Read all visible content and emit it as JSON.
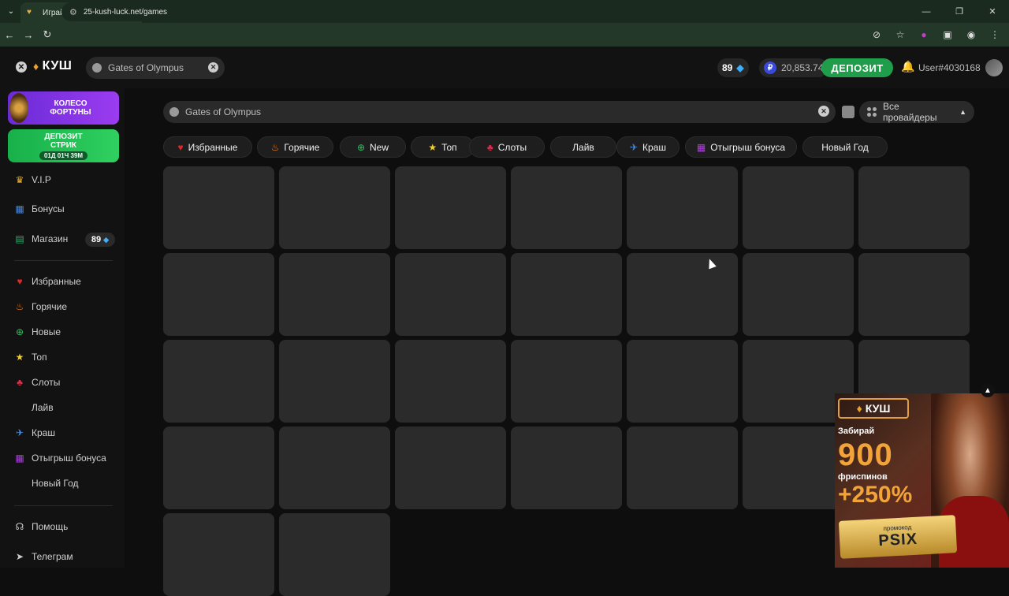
{
  "browser": {
    "tab_title": "Играй в Игры ⊳ в казино КУШ",
    "url": "25-kush-luck.net/games"
  },
  "header": {
    "logo": "КУШ",
    "search_value": "Gates of Olympus",
    "gems_count": "89",
    "balance": "20,853.74",
    "currency_symbol": "₽",
    "deposit_label": "ДЕПОЗИТ",
    "username": "User#4030168"
  },
  "sidebar": {
    "wheel_label": "КОЛЕСО ФОРТУНЫ",
    "streak_label": "ДЕПОЗИТ СТРИК",
    "streak_timer": "01Д 01Ч 39М",
    "top_items": [
      {
        "label": "V.I.P",
        "icon": "crown-icon"
      },
      {
        "label": "Бонусы",
        "icon": "gift-icon"
      },
      {
        "label": "Магазин",
        "icon": "shop-icon"
      }
    ],
    "shop_badge": "89",
    "categories": [
      {
        "label": "Избранные",
        "icon": "heart-icon"
      },
      {
        "label": "Горячие",
        "icon": "fire-icon"
      },
      {
        "label": "Новые",
        "icon": "plus-icon"
      },
      {
        "label": "Топ",
        "icon": "star-icon"
      },
      {
        "label": "Слоты",
        "icon": "cherry-icon"
      },
      {
        "label": "Лайв",
        "icon": ""
      },
      {
        "label": "Краш",
        "icon": "plane-icon"
      },
      {
        "label": "Отыгрыш бонуса",
        "icon": "gift-icon"
      },
      {
        "label": "Новый Год",
        "icon": ""
      }
    ],
    "bottom_items": [
      {
        "label": "Помощь",
        "icon": "headset-icon"
      },
      {
        "label": "Телеграм",
        "icon": "telegram-icon"
      }
    ]
  },
  "main": {
    "search_value": "Gates of Olympus",
    "providers_label": "Все провайдеры",
    "chips": [
      {
        "label": "Избранные",
        "icon": "heart-icon"
      },
      {
        "label": "Горячие",
        "icon": "fire-icon"
      },
      {
        "label": "New",
        "icon": "plus-icon"
      },
      {
        "label": "Топ",
        "icon": "star-icon"
      },
      {
        "label": "Слоты",
        "icon": "cherry-icon"
      },
      {
        "label": "Лайв",
        "icon": ""
      },
      {
        "label": "Краш",
        "icon": "plane-icon"
      },
      {
        "label": "Отыгрыш бонуса",
        "icon": "gift-icon"
      },
      {
        "label": "Новый Год",
        "icon": ""
      }
    ]
  },
  "ad": {
    "logo": "КУШ",
    "line1": "Забирай",
    "big": "900",
    "line2": "фриспинов",
    "percent": "+250%",
    "promo_label": "промокод",
    "promo_code": "PSIX"
  },
  "colors": {
    "deposit": "#1f9d4a",
    "wheel": "#8a34e8",
    "streak": "#22b850",
    "gold": "#f2a33a"
  }
}
